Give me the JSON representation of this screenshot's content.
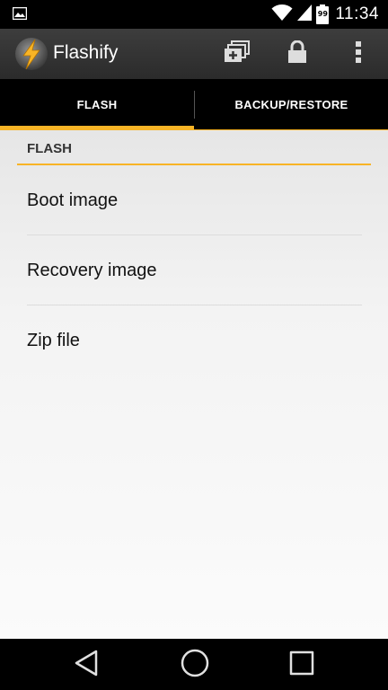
{
  "status_bar": {
    "time": "11:34",
    "battery_level": "99",
    "icons": [
      "gallery-icon",
      "wifi-icon",
      "signal-icon",
      "battery-icon"
    ]
  },
  "action_bar": {
    "title": "Flashify",
    "icons": [
      "flashify-logo-icon",
      "add-stack-icon",
      "lock-icon",
      "overflow-menu-icon"
    ]
  },
  "tabs": [
    {
      "label": "FLASH",
      "selected": true
    },
    {
      "label": "BACKUP/RESTORE",
      "selected": false
    }
  ],
  "content": {
    "section_header": "FLASH",
    "items": [
      {
        "label": "Boot image"
      },
      {
        "label": "Recovery image"
      },
      {
        "label": "Zip file"
      }
    ]
  },
  "nav_bar": {
    "icons": [
      "back-icon",
      "home-icon",
      "recents-icon"
    ]
  },
  "colors": {
    "accent": "#f8b426",
    "action_bar": "#333333",
    "tab_bar": "#000000",
    "content_bg": "#f2f2f2"
  }
}
